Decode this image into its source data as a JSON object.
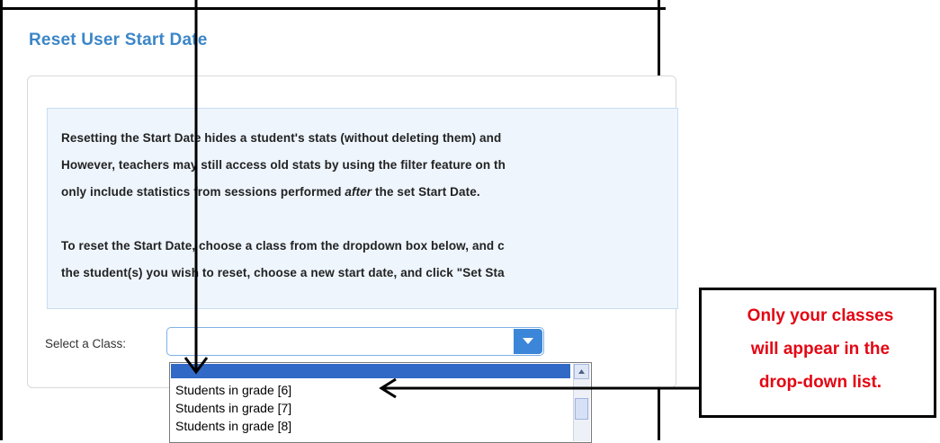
{
  "page": {
    "title": "Reset User Start Date"
  },
  "info": {
    "paragraph1_line1": "Resetting the Start Date hides a student's stats (without deleting them) and",
    "paragraph1_line2": "However, teachers may still access old stats by using the filter feature on th",
    "paragraph1_line3_a": "only include statistics from sessions performed ",
    "paragraph1_line3_em": "after",
    "paragraph1_line3_b": " the set Start Date.",
    "paragraph2_line1": "To reset the Start Date, choose a class from the dropdown box below, and c",
    "paragraph2_line2": "the student(s) you wish to reset, choose a new start date, and click \"Set Sta"
  },
  "select": {
    "label": "Select a Class:",
    "value": "",
    "options": [
      "",
      "Students in grade [6]",
      "Students in grade [7]",
      "Students in grade [8]"
    ]
  },
  "callout": {
    "line1": "Only your classes",
    "line2": "will appear in the",
    "line3": "drop-down list."
  },
  "colors": {
    "title": "#3b86c8",
    "callout_text": "#e30613",
    "highlight": "#3169c6",
    "info_bg": "#eef5fd"
  }
}
